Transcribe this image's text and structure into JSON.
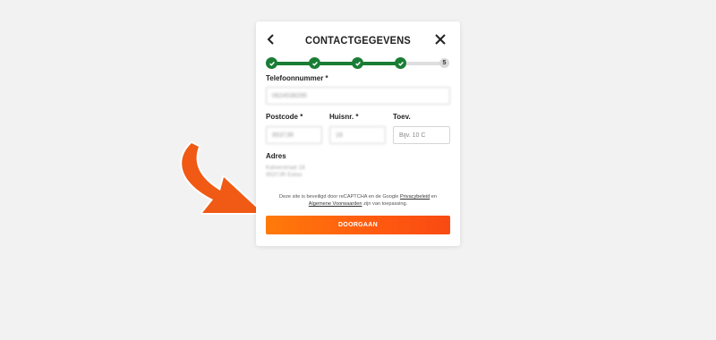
{
  "dialog": {
    "title": "CONTACTGEGEVENS",
    "back_icon": "chevron-left-icon",
    "close_icon": "close-icon"
  },
  "stepper": {
    "total_steps": 5,
    "completed_steps": 4,
    "last_step_label": "5",
    "completed_color": "#1a7d35",
    "pending_color": "#dedede"
  },
  "form": {
    "phone": {
      "label": "Telefoonnummer *",
      "value": "0624538295"
    },
    "postcode": {
      "label": "Postcode *",
      "value": "9537JR"
    },
    "house_number": {
      "label": "Huisnr. *",
      "value": "18"
    },
    "addition": {
      "label": "Toev.",
      "placeholder": "Bijv. 10 C",
      "value": ""
    },
    "address": {
      "label": "Adres",
      "line1": "Kalverstraat 18",
      "line2": "9537JR Exloo"
    }
  },
  "legal": {
    "text_before": "Deze site is beveiligd door reCAPTCHA en de Google ",
    "privacy_link": "Privacybeleid",
    "text_middle": " en ",
    "terms_link": "Algemene Voorwaarden",
    "text_after": " zijn van toepassing."
  },
  "cta": {
    "label": "DOORGAAN",
    "color": "#ff6a0d"
  },
  "annotation": {
    "arrow_color": "#f05a14"
  }
}
